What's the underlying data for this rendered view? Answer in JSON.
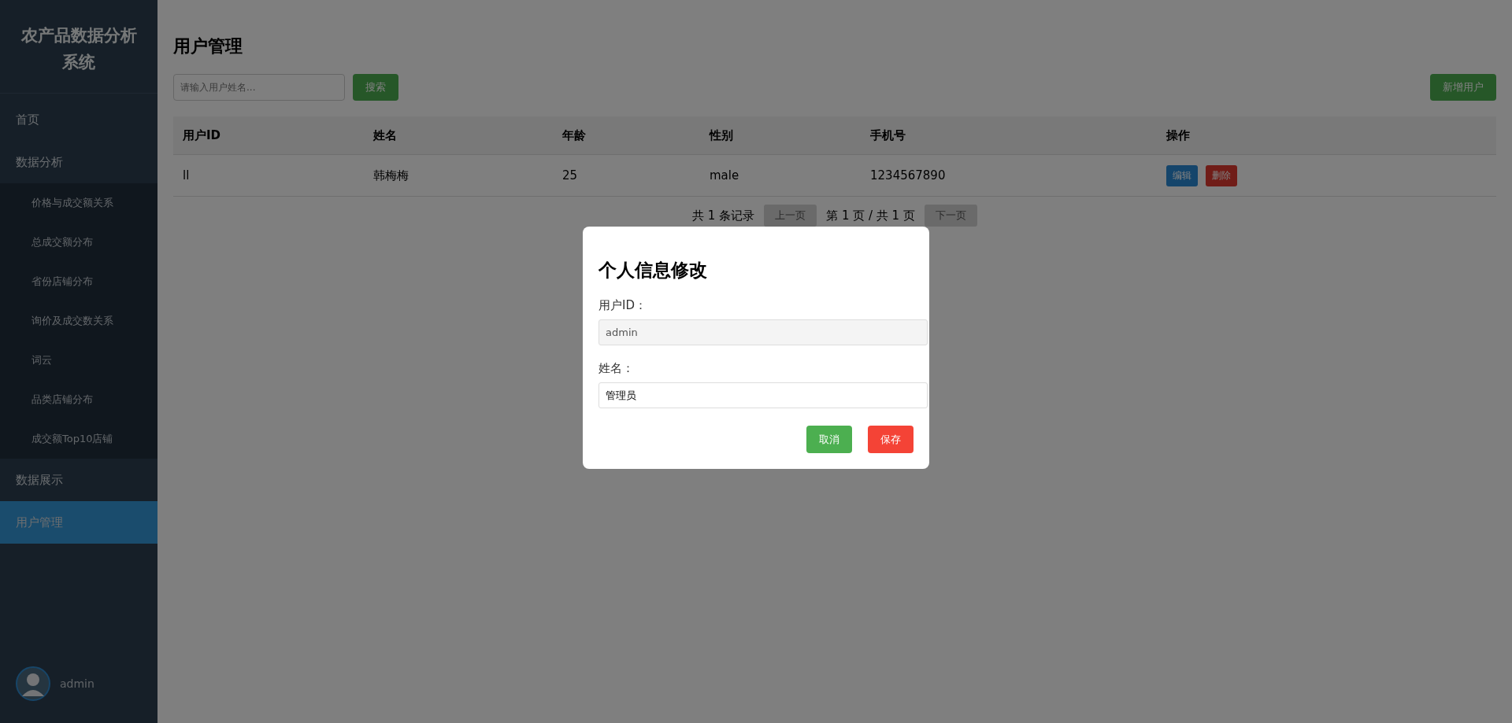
{
  "sidebar": {
    "title": "农产品数据分析系统",
    "items": [
      {
        "label": "首页",
        "selected": false
      },
      {
        "label": "数据分析",
        "selected": false,
        "expanded": true,
        "children": [
          {
            "label": "价格与成交额关系",
            "selected": false
          },
          {
            "label": "总成交额分布",
            "selected": false
          },
          {
            "label": "省份店铺分布",
            "selected": false
          },
          {
            "label": "询价及成交数关系",
            "selected": false
          },
          {
            "label": "词云",
            "selected": false
          },
          {
            "label": "品类店铺分布",
            "selected": false
          },
          {
            "label": "成交额Top10店铺",
            "selected": false
          }
        ]
      },
      {
        "label": "数据展示",
        "selected": false
      },
      {
        "label": "用户管理",
        "selected": true
      }
    ],
    "user": {
      "name": "admin"
    }
  },
  "page": {
    "title": "用户管理",
    "search": {
      "placeholder": "请输入用户姓名..."
    },
    "search_button": "搜索",
    "add_button": "新增用户",
    "table": {
      "columns": [
        "用户ID",
        "姓名",
        "年龄",
        "性别",
        "手机号",
        "操作"
      ],
      "rows": [
        {
          "cells": [
            "ll",
            "韩梅梅",
            "25",
            "male",
            "1234567890"
          ],
          "actions": [
            {
              "label": "编辑",
              "kind": "edit"
            },
            {
              "label": "删除",
              "kind": "delete"
            }
          ]
        }
      ]
    },
    "pagination": {
      "total": "共 1 条记录",
      "prev": "上一页",
      "page": "第 1 页 / 共 1 页",
      "next": "下一页",
      "prev_disabled": true,
      "next_disabled": true
    }
  },
  "dialog": {
    "title": "个人信息修改",
    "fields": [
      {
        "label": "用户ID：",
        "value": "admin",
        "disabled": true
      },
      {
        "label": "姓名：",
        "value": "管理员",
        "disabled": false
      }
    ],
    "buttons": [
      {
        "label": "取消",
        "kind": "cancel"
      },
      {
        "label": "保存",
        "kind": "save"
      }
    ]
  }
}
